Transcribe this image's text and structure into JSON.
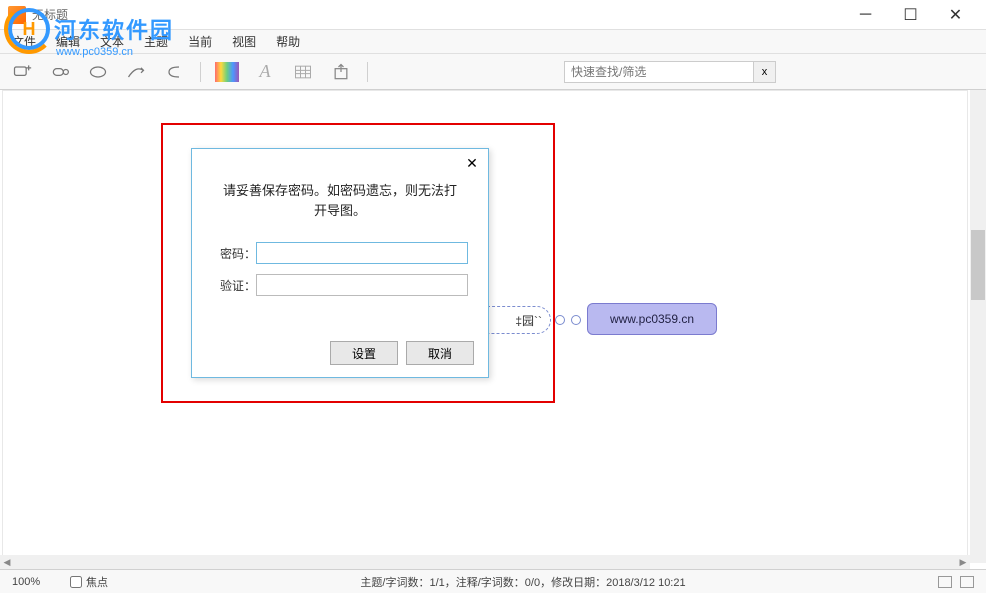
{
  "window": {
    "title": "无标题"
  },
  "menu": {
    "items": [
      "文件",
      "编辑",
      "文本",
      "主题",
      "当前",
      "视图",
      "帮助"
    ]
  },
  "watermark": {
    "text": "河东软件园",
    "url": "www.pc0359.cn"
  },
  "search": {
    "placeholder": "快速查找/筛选",
    "clear": "x"
  },
  "mindmap": {
    "node1": "‡园``",
    "node2": "www.pc0359.cn"
  },
  "dialog": {
    "message": "请妥善保存密码。如密码遗忘，则无法打开导图。",
    "password_label": "密码：",
    "verify_label": "验证：",
    "set_btn": "设置",
    "cancel_btn": "取消"
  },
  "status": {
    "zoom": "100%",
    "focus_label": "焦点",
    "info": "主题/字词数：1/1，注释/字词数：0/0，修改日期：2018/3/12 10:21"
  }
}
